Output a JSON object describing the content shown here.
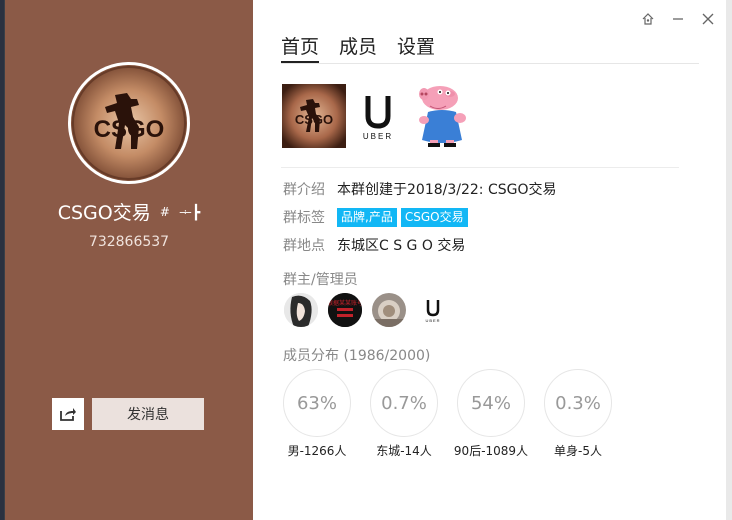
{
  "window": {
    "controls": {
      "skin": "skin-icon",
      "minimize": "minimize-icon",
      "close": "close-icon"
    }
  },
  "profile": {
    "group_name": "CSGO交易",
    "name_hash": "#",
    "name_sym": "ᆠ┣",
    "group_id": "732866537",
    "avatar_text": "CSGO",
    "share_icon": "share-icon",
    "send_message": "发消息"
  },
  "tabs": [
    {
      "label": "首页"
    },
    {
      "label": "成员"
    },
    {
      "label": "设置"
    }
  ],
  "photos": {
    "uber_text": "UBER"
  },
  "info": {
    "intro_label": "群介绍",
    "intro_value": "本群创建于2018/3/22: CSGO交易",
    "tags_label": "群标签",
    "tags": [
      "品牌,产品",
      "CSGO交易"
    ],
    "location_label": "群地点",
    "location_value": "东城区C S G O 交易"
  },
  "admins": {
    "title": "群主/管理员",
    "red_avatar_text": "根据某某账号",
    "uber_text": "UBER"
  },
  "members": {
    "title": "成员分布 (1986/2000)",
    "stats": [
      {
        "value": "63%",
        "label": "男-1266人"
      },
      {
        "value": "0.7%",
        "label": "东城-14人"
      },
      {
        "value": "54%",
        "label": "90后-1089人"
      },
      {
        "value": "0.3%",
        "label": "单身-5人"
      }
    ]
  }
}
